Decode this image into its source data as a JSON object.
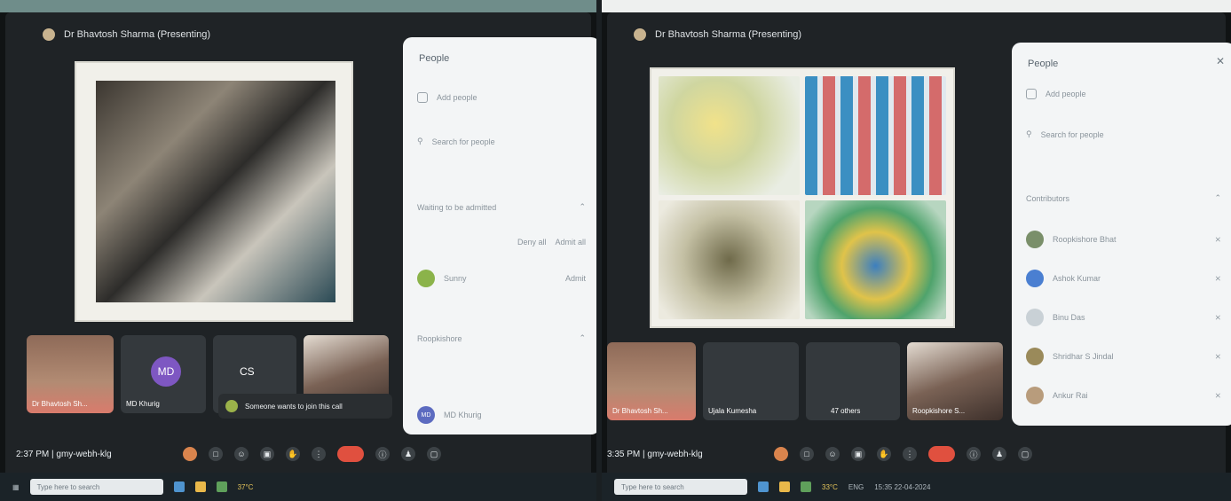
{
  "left": {
    "presenter": "Dr Bhavtosh Sharma (Presenting)",
    "panel_title": "People",
    "panel_add": "Add people",
    "panel_search": "Search for people",
    "panel_waiting": "Waiting to be admitted",
    "panel_deny": "Deny all",
    "panel_admit_all": "Admit all",
    "panel_waiting_person": "Sunny",
    "panel_admit": "Admit",
    "panel_section": "Roopkishore",
    "panel_person": "MD Khurig",
    "tiles": [
      {
        "label": "Dr Bhavtosh Sh..."
      },
      {
        "label": "MD Khurig",
        "initials": "MD"
      },
      {
        "label": "CS"
      },
      {
        "label": ""
      }
    ],
    "toast": "Someone wants to join this call",
    "time": "2:37 PM",
    "code": "gmy-webh-klg",
    "taskbar_search": "Type here to search",
    "weather": "37°C"
  },
  "right": {
    "presenter": "Dr Bhavtosh Sharma (Presenting)",
    "panel_title": "People",
    "panel_add": "Add people",
    "panel_search": "Search for people",
    "panel_section": "Contributors",
    "participants": [
      "Roopkishore Bhat",
      "Ashok Kumar",
      "Binu Das",
      "Shridhar S Jindal",
      "Ankur Rai"
    ],
    "tiles": [
      {
        "label": "Dr Bhavtosh Sh..."
      },
      {
        "label": "Ujala Kumesha"
      },
      {
        "label": "47 others"
      },
      {
        "label": "Roopkishore S..."
      }
    ],
    "time": "3:35 PM",
    "code": "gmy-webh-klg",
    "taskbar_search": "Type here to search",
    "weather": "33°C",
    "lang": "ENG",
    "clock": "15:35",
    "date": "22-04-2024"
  }
}
